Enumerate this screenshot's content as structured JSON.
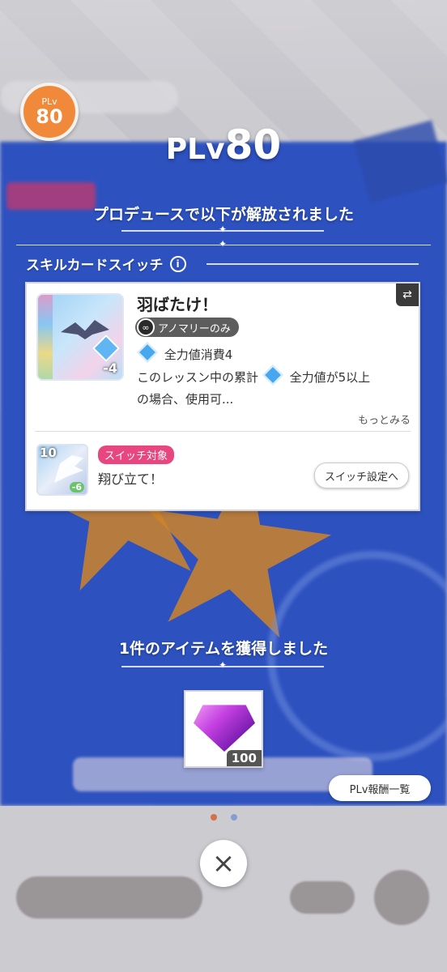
{
  "level": {
    "prefix": "PLv",
    "value": "80"
  },
  "badge": {
    "small": "PLv",
    "num": "80"
  },
  "unlock_message": "プロデュースで以下が解放されました",
  "section": {
    "label": "スキルカードスイッチ",
    "info_icon": "i"
  },
  "card": {
    "name": "羽ばたけ！",
    "tag": "アノマリーのみ",
    "cost": "-4",
    "effect1": "全力値消費4",
    "effect2_a": "このレッスン中の累計",
    "effect2_b": "全力値が5以上",
    "effect3": "の場合、使用可...",
    "more_label": "もっとみる"
  },
  "switch_target": {
    "level": "10",
    "tag": "スイッチ対象",
    "name": "翔び立て！",
    "cost": "-6",
    "button_label": "スイッチ設定へ"
  },
  "items": {
    "title": "1件のアイテムを獲得しました",
    "quantity": "100"
  },
  "reward_list_button": "PLv報酬一覧",
  "close_icon": "×",
  "colors": {
    "badge": "#f08a3a",
    "switch_tag": "#e8467f",
    "background_blue": "#2f56c9"
  }
}
